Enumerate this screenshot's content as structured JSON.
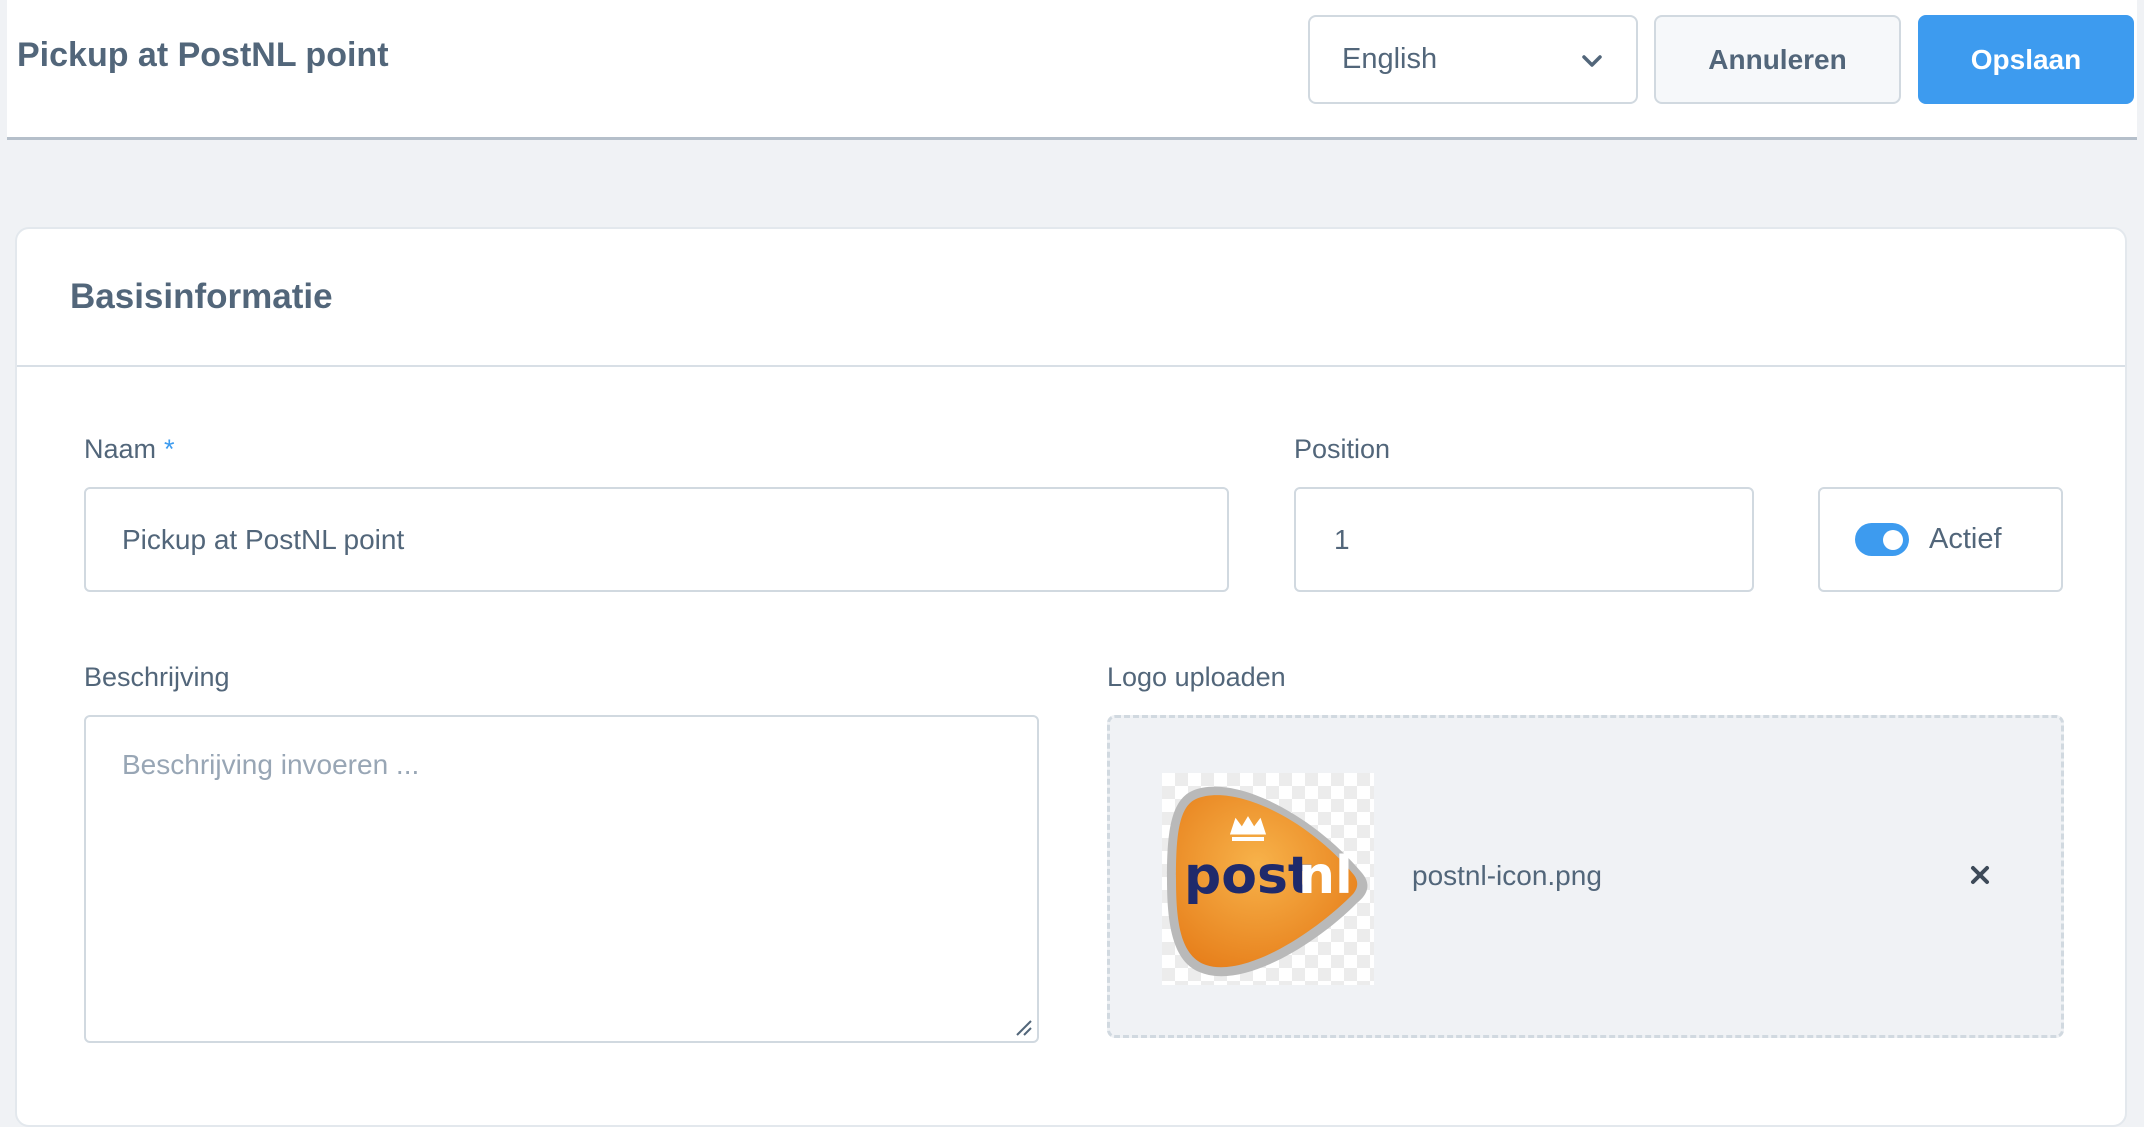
{
  "header": {
    "title": "Pickup at PostNL point",
    "language": {
      "selected": "English",
      "icon": "chevron-down-icon"
    },
    "cancel_label": "Annuleren",
    "save_label": "Opslaan"
  },
  "card": {
    "title": "Basisinformatie",
    "name_field": {
      "label": "Naam",
      "required_marker": "*",
      "value": "Pickup at PostNL point"
    },
    "position_field": {
      "label": "Position",
      "value": "1"
    },
    "active_toggle": {
      "label": "Actief",
      "on": true
    },
    "description_field": {
      "label": "Beschrijving",
      "placeholder": "Beschrijving invoeren ..."
    },
    "logo_upload": {
      "label": "Logo uploaden",
      "file_name": "postnl-icon.png",
      "logo_text_a": "post",
      "logo_text_b": "nl",
      "remove_icon": "close-icon"
    }
  },
  "colors": {
    "primary": "#3d9bef",
    "text": "#52667a",
    "placeholder": "#98a6b5",
    "logo_orange": "#f39c2a",
    "logo_navy": "#1f2a6b"
  }
}
